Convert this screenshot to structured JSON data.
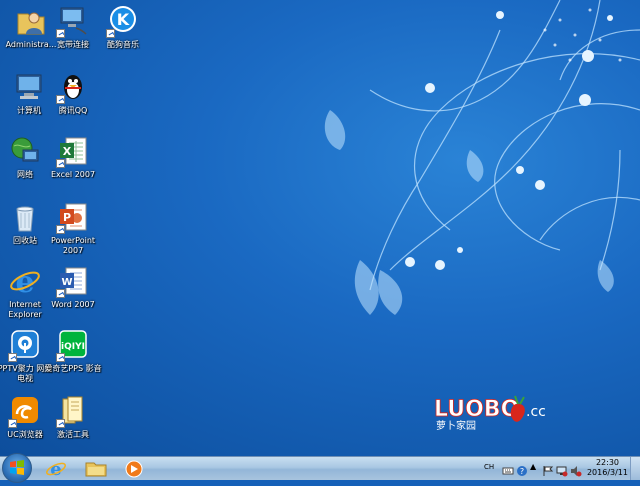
{
  "desktop_icons": [
    {
      "id": "administrator",
      "label": "Administra..."
    },
    {
      "id": "broadband",
      "label": "宽带连接"
    },
    {
      "id": "kugou",
      "label": "酷狗音乐"
    },
    {
      "id": "computer",
      "label": "计算机"
    },
    {
      "id": "qq",
      "label": "腾讯QQ"
    },
    {
      "id": "network",
      "label": "网络"
    },
    {
      "id": "excel",
      "label": "Excel 2007"
    },
    {
      "id": "recycle",
      "label": "回收站"
    },
    {
      "id": "powerpoint",
      "label": "PowerPoint 2007"
    },
    {
      "id": "ie",
      "label": "Internet Explorer"
    },
    {
      "id": "word",
      "label": "Word 2007"
    },
    {
      "id": "pptv",
      "label": "PPTV聚力 网络电视"
    },
    {
      "id": "iqiyi",
      "label": "爱奇艺PPS 影音"
    },
    {
      "id": "uc",
      "label": "UC浏览器"
    },
    {
      "id": "activate",
      "label": "激活工具"
    }
  ],
  "logo": {
    "text": "LUOBO",
    "suffix": ".cc",
    "subtitle": "萝卜家园"
  },
  "tray": {
    "lang": "CH",
    "time": "22:30",
    "date": "2016/3/11"
  },
  "icons": {
    "start": "windows-logo-icon",
    "taskbar": [
      "internet-explorer-icon",
      "folder-icon",
      "media-player-icon"
    ]
  },
  "colors": {
    "desktop": "#1560b8",
    "taskbar": "#a9c7e3",
    "excel": "#1e7a3a",
    "powerpoint": "#d24a1e",
    "word": "#2a5bb0",
    "iqiyi": "#00b43c",
    "uc": "#f08a00"
  }
}
